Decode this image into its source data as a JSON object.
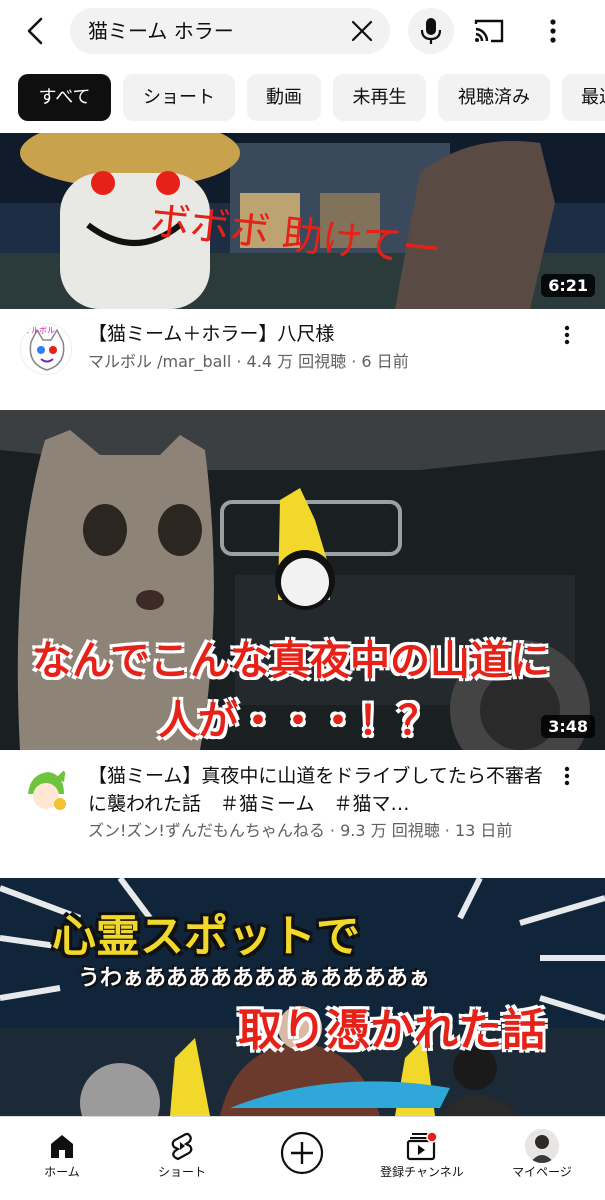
{
  "search": {
    "query": "猫ミーム ホラー"
  },
  "filters": [
    {
      "label": "すべて",
      "active": true
    },
    {
      "label": "ショート",
      "active": false
    },
    {
      "label": "動画",
      "active": false
    },
    {
      "label": "未再生",
      "active": false
    },
    {
      "label": "視聴済み",
      "active": false
    },
    {
      "label": "最近",
      "active": false
    }
  ],
  "videos": [
    {
      "title": "【猫ミーム＋ホラー】八尺様",
      "subtitle": "マルボル /mar_ball · 4.4 万 回視聴 · 6 日前",
      "duration": "6:21",
      "thumb_text": "ボボボ 助けてー"
    },
    {
      "title": "【猫ミーム】真夜中に山道をドライブしてたら不審者に襲われた話　＃猫ミーム　＃猫マ…",
      "subtitle": "ズン!ズン!ずんだもんちゃんねる · 9.3 万 回視聴 · 13 日前",
      "duration": "3:48",
      "thumb_text_1": "なんでこんな真夜中の山道に",
      "thumb_text_2": "人が・・・！？"
    },
    {
      "thumb_text_1": "心霊スポットで",
      "thumb_text_2": "うわぁあああああああぁああああぁ",
      "thumb_text_3": "取り憑かれた話"
    }
  ],
  "avatar_text": {
    "channel1": "マルボル"
  },
  "nav": [
    {
      "label": "ホーム",
      "icon": "home-icon"
    },
    {
      "label": "ショート",
      "icon": "shorts-icon"
    },
    {
      "label": "",
      "icon": "create-icon"
    },
    {
      "label": "登録チャンネル",
      "icon": "subscriptions-icon"
    },
    {
      "label": "マイページ",
      "icon": "profile-icon"
    }
  ],
  "colors": {
    "accent_red": "#e62117",
    "chip_active_bg": "#0f0f0f",
    "chip_bg": "#f2f2f2",
    "subtext": "#606060"
  }
}
